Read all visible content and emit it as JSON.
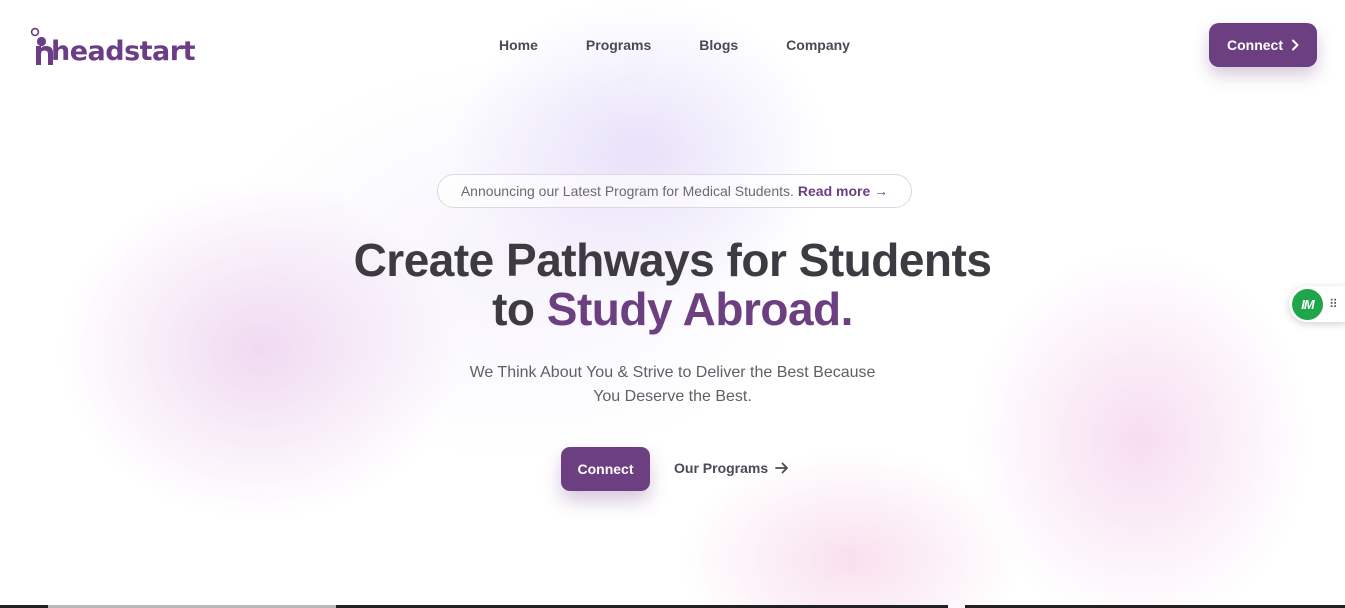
{
  "brand": {
    "name": "headstart",
    "color": "#6b3f80"
  },
  "nav": {
    "links": [
      {
        "label": "Home"
      },
      {
        "label": "Programs"
      },
      {
        "label": "Blogs"
      },
      {
        "label": "Company"
      }
    ],
    "connect_label": "Connect",
    "connect_icon": "chevron-right-icon"
  },
  "hero": {
    "announcement": {
      "text": "Announcing our Latest Program for Medical Students.",
      "link_label": "Read more →"
    },
    "title_line1": "Create Pathways for Students",
    "title_line2_prefix": "to",
    "title_line2_accent": "Study Abroad.",
    "subtitle_line1": "We Think About You & Strive to Deliver the Best Because",
    "subtitle_line2": "You Deserve the Best.",
    "primary_button": "Connect",
    "secondary_link": "Our Programs",
    "secondary_icon": "arrow-right-icon"
  },
  "widget": {
    "badge_text": "IM",
    "badge_color": "#1fa64a",
    "grip_icon": "drag-handle-icon"
  }
}
